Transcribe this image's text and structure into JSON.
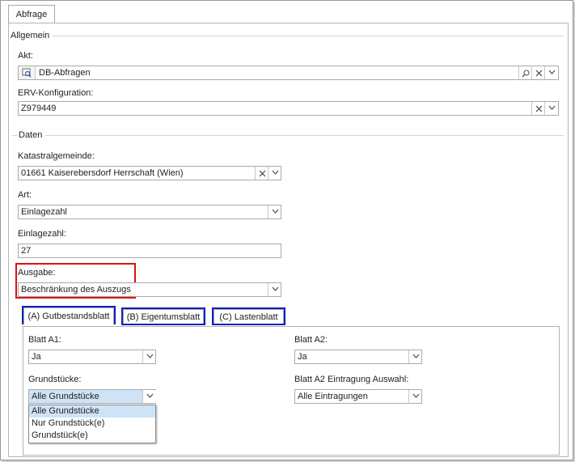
{
  "window_tab": "Abfrage",
  "sections": {
    "allgemein": "Allgemein",
    "daten": "Daten"
  },
  "akt": {
    "label": "Akt:",
    "value": "DB-Abfragen"
  },
  "erv": {
    "label": "ERV-Konfiguration:",
    "value": "Z979449"
  },
  "katastral": {
    "label": "Katastralgemeinde:",
    "value": "01661 Kaiserebersdorf Herrschaft (Wien)"
  },
  "art": {
    "label": "Art:",
    "value": "Einlagezahl"
  },
  "einlagezahl": {
    "label": "Einlagezahl:",
    "value": "27"
  },
  "ausgabe": {
    "label": "Ausgabe:",
    "value": "Beschränkung des Auszugs"
  },
  "tabs": [
    {
      "label": "(A) Gutbestandsblatt"
    },
    {
      "label": "(B) Eigentumsblatt"
    },
    {
      "label": "(C) Lastenblatt"
    }
  ],
  "blatt_a1": {
    "label": "Blatt A1:",
    "value": "Ja"
  },
  "blatt_a2": {
    "label": "Blatt A2:",
    "value": "Ja"
  },
  "grundstuecke": {
    "label": "Grundstücke:",
    "value": "Alle Grundstücke",
    "options": [
      "Alle Grundstücke",
      "Nur Grundstück(e)",
      "Grundstück(e)"
    ]
  },
  "a2_auswahl": {
    "label": "Blatt A2 Eintragung Auswahl:",
    "value": "Alle Eintragungen"
  },
  "icons": {
    "browse": "browse-icon",
    "search": "search-icon",
    "clear": "clear-icon",
    "dropdown": "chevron-down-icon"
  },
  "colors": {
    "highlight_red": "#e01010",
    "highlight_blue": "#1020c0",
    "selected_item": "#cfe3f7"
  }
}
